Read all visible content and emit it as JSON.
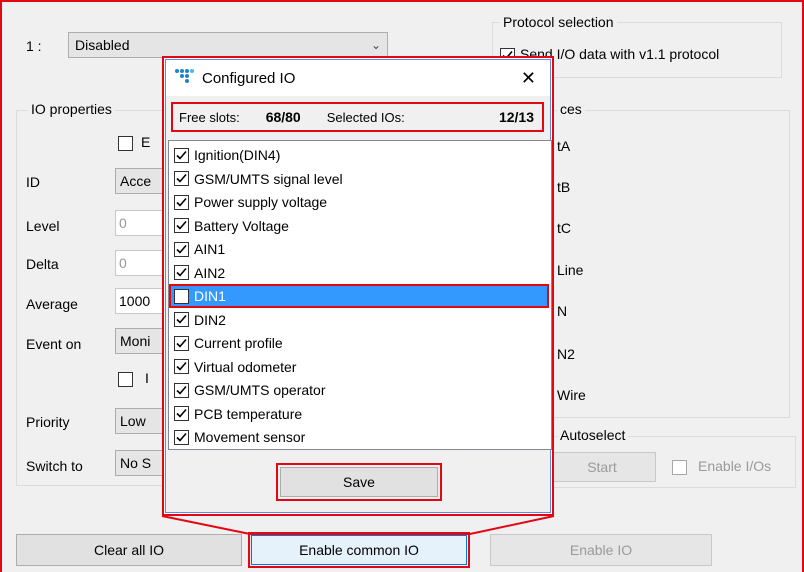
{
  "top": {
    "index_label": "1 :",
    "mode_value": "Disabled"
  },
  "io_properties": {
    "title": "IO properties",
    "enable_label_partial": "E",
    "id_label": "ID",
    "id_value": "Acce",
    "level_label": "Level",
    "level_value": "0",
    "delta_label": "Delta",
    "delta_value": "0",
    "average_label": "Average",
    "average_value": "1000",
    "event_on_label": "Event on",
    "event_on_value": "Moni",
    "include_label_partial": "I",
    "priority_label": "Priority",
    "priority_value": "Low",
    "switch_to_label": "Switch to",
    "switch_to_value": "No S"
  },
  "protocol": {
    "title": "Protocol selection",
    "checkbox_label": "Send I/O data with v1.1 protocol"
  },
  "sources": {
    "title_partial": "ces",
    "items": [
      "tA",
      "tB",
      "tC",
      "Line",
      "N",
      "N2",
      "Wire"
    ]
  },
  "autoselect": {
    "title_partial": "Autoselect",
    "start_label": "Start",
    "enable_ios_label": "Enable I/Os"
  },
  "bottom": {
    "clear_all": "Clear all IO",
    "enable_common": "Enable common IO",
    "enable_io": "Enable IO"
  },
  "dialog": {
    "logo_icon": "teltonika-logo-icon",
    "title": "Configured IO",
    "close": "✕",
    "free_slots_label": "Free slots:",
    "free_slots_value": "68/80",
    "selected_label": "Selected IOs:",
    "selected_value": "12/13",
    "items": [
      {
        "label": "Ignition(DIN4)",
        "checked": true
      },
      {
        "label": "GSM/UMTS signal level",
        "checked": true
      },
      {
        "label": "Power supply voltage",
        "checked": true
      },
      {
        "label": "Battery Voltage",
        "checked": true
      },
      {
        "label": "AIN1",
        "checked": true
      },
      {
        "label": "AIN2",
        "checked": true
      },
      {
        "label": "DIN1",
        "checked": false
      },
      {
        "label": "DIN2",
        "checked": true
      },
      {
        "label": "Current profile",
        "checked": true
      },
      {
        "label": "Virtual odometer",
        "checked": true
      },
      {
        "label": "GSM/UMTS operator",
        "checked": true
      },
      {
        "label": "PCB temperature",
        "checked": true
      },
      {
        "label": "Movement sensor",
        "checked": true
      }
    ],
    "save": "Save"
  },
  "colors": {
    "highlight_red": "#e30613",
    "selection_blue": "#3399ff",
    "focus_blue": "#0078d7"
  }
}
